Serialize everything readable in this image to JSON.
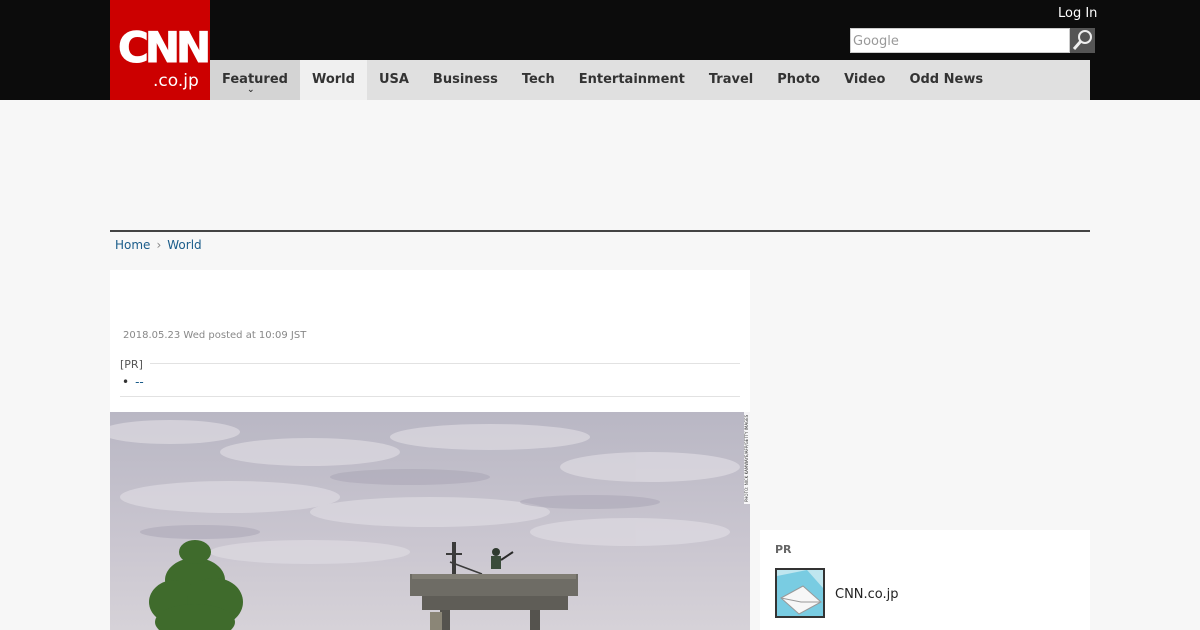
{
  "header": {
    "logo_main": "CNN",
    "logo_sub": ".co.jp",
    "login_label": "Log In",
    "search_placeholder": "Google",
    "search_icon": "magnifier-icon"
  },
  "nav": {
    "items": [
      {
        "label": "Featured"
      },
      {
        "label": "World"
      },
      {
        "label": "USA"
      },
      {
        "label": "Business"
      },
      {
        "label": "Tech"
      },
      {
        "label": "Entertainment"
      },
      {
        "label": "Travel"
      },
      {
        "label": "Photo"
      },
      {
        "label": "Video"
      },
      {
        "label": "Odd News"
      }
    ],
    "active": "World",
    "featured_icon": "chevron-down-icon"
  },
  "breadcrumb": {
    "home": "Home",
    "separator": "›",
    "current": "World"
  },
  "article": {
    "posted": "2018.05.23 Wed posted at 10:09 JST",
    "pr_label": "[PR]",
    "pr_dot": "•",
    "pr_link": "--",
    "photo_credit": "PHOTO: NICK KAMWAYE/AFP/GETTY IMAGES"
  },
  "sidebar": {
    "pr_heading": "PR",
    "pr_title": "CNN.co.jp",
    "pr_icon": "envelope-icon"
  },
  "colors": {
    "brand_red": "#cc0000",
    "topbar": "#0c0c0c",
    "link": "#1a5c8a"
  }
}
